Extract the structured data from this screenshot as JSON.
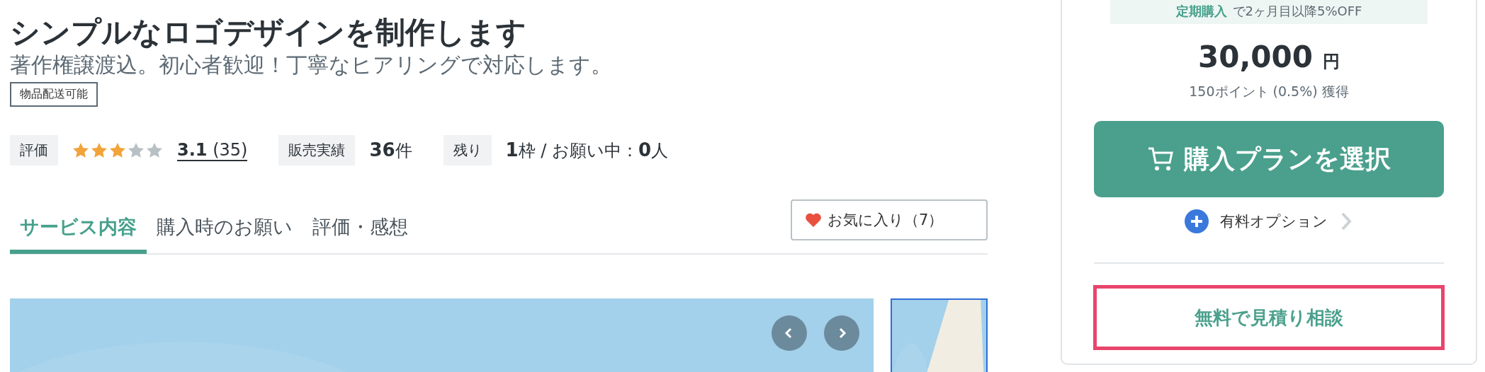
{
  "title": "シンプルなロゴデザインを制作します",
  "subtitle": "著作権譲渡込。初心者歓迎！丁寧なヒアリングで対応します。",
  "tag": "物品配送可能",
  "stats": [
    {
      "kind": "rating",
      "label": "評価",
      "stars": 3,
      "score": "3.1",
      "count": "(35)"
    },
    {
      "kind": "text",
      "label": "販売実績",
      "value": "36",
      "unit": "件"
    },
    {
      "kind": "slots",
      "label": "残り",
      "value": "1",
      "unit": "枠",
      "sep": "/",
      "label2": "お願い中：",
      "value2": "0",
      "unit2": "人"
    }
  ],
  "tabs": [
    {
      "label": "サービス内容",
      "selected": true
    },
    {
      "label": "購入時のお願い",
      "selected": false
    },
    {
      "label": "評価・感想",
      "selected": false
    }
  ],
  "favorite": {
    "label": "お気に入り（7）",
    "on": true
  },
  "gallery": {
    "main": {
      "kind": "picture"
    },
    "thumbnails": [
      {
        "kind": "picture",
        "selected": true
      }
    ]
  },
  "purchase": {
    "banner": {
      "highlight": "定期購入",
      "text": "で2ヶ月目以降5%OFF"
    },
    "price": "30,000",
    "currency": "円",
    "points": "150ポイント (0.5%) 獲得",
    "buy_button": "購入プランを選択",
    "option": "有料オプション",
    "consult_button": "無料で見積り相談"
  }
}
